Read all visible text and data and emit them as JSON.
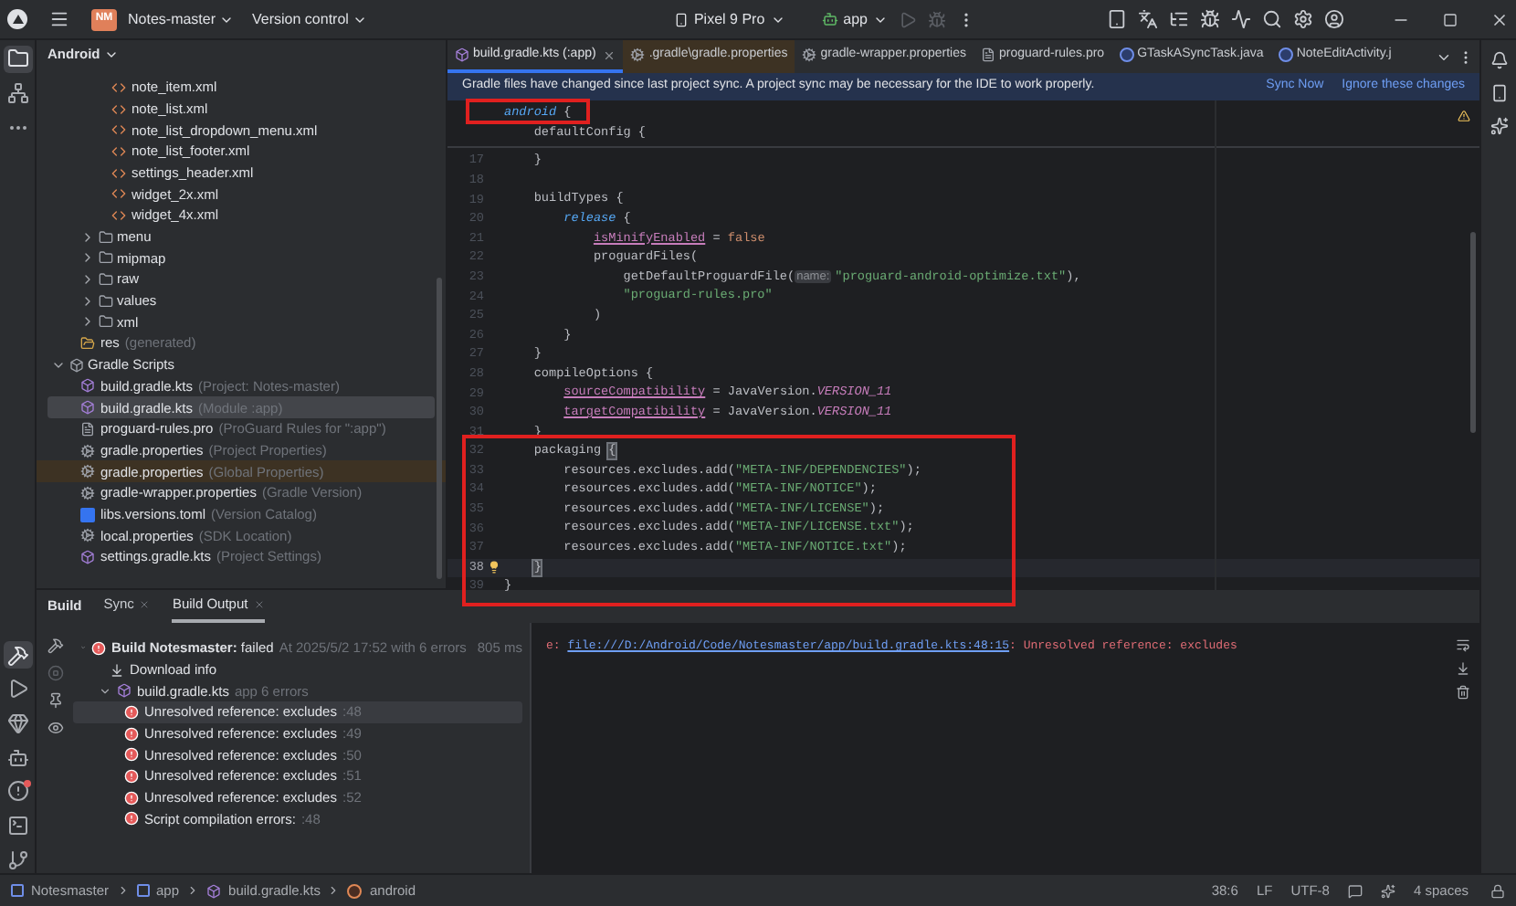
{
  "title_bar": {
    "project_badge": "NM",
    "project": "Notes-master",
    "vcs": "Version control",
    "device": "Pixel 9 Pro",
    "run_config": "app"
  },
  "left_toolbar": {
    "top": [
      {
        "kind": "project",
        "selected": true
      },
      {
        "kind": "structure",
        "selected": false
      },
      {
        "kind": "more",
        "selected": false
      }
    ],
    "bottom": [
      {
        "kind": "build",
        "selected": true
      },
      {
        "kind": "run",
        "selected": false
      },
      {
        "kind": "gem",
        "selected": false
      },
      {
        "kind": "robot",
        "selected": false
      },
      {
        "kind": "problems",
        "selected": false
      },
      {
        "kind": "terminal",
        "selected": false
      },
      {
        "kind": "git",
        "selected": false
      }
    ]
  },
  "project_panel": {
    "view": "Android",
    "res_files": [
      "note_item.xml",
      "note_list.xml",
      "note_list_dropdown_menu.xml",
      "note_list_footer.xml",
      "settings_header.xml",
      "widget_2x.xml",
      "widget_4x.xml"
    ],
    "res_folders": [
      {
        "label": "menu",
        "expanded": false
      },
      {
        "label": "mipmap",
        "expanded": false
      },
      {
        "label": "raw",
        "expanded": false
      },
      {
        "label": "values",
        "expanded": false
      },
      {
        "label": "xml",
        "expanded": false
      }
    ],
    "generated": {
      "label": "res",
      "hint": "(generated)"
    },
    "gradle_scripts": {
      "label": "Gradle Scripts",
      "expanded": true,
      "children": [
        {
          "kind": "gradle",
          "label": "build.gradle.kts",
          "hint": "(Project: Notes-master)",
          "selected": false,
          "marked": false
        },
        {
          "kind": "gradle",
          "label": "build.gradle.kts",
          "hint": "(Module :app)",
          "selected": true,
          "marked": false
        },
        {
          "kind": "rules",
          "label": "proguard-rules.pro",
          "hint": "(ProGuard Rules for \":app\")",
          "selected": false,
          "marked": false
        },
        {
          "kind": "properties",
          "label": "gradle.properties",
          "hint": "(Project Properties)",
          "selected": false,
          "marked": false
        },
        {
          "kind": "properties",
          "label": "gradle.properties",
          "hint": "(Global Properties)",
          "selected": false,
          "marked": true
        },
        {
          "kind": "properties",
          "label": "gradle-wrapper.properties",
          "hint": "(Gradle Version)",
          "selected": false,
          "marked": false
        },
        {
          "kind": "toml",
          "label": "libs.versions.toml",
          "hint": "(Version Catalog)",
          "selected": false,
          "marked": false
        },
        {
          "kind": "properties",
          "label": "local.properties",
          "hint": "(SDK Location)",
          "selected": false,
          "marked": false
        },
        {
          "kind": "gradle",
          "label": "settings.gradle.kts",
          "hint": "(Project Settings)",
          "selected": false,
          "marked": false
        }
      ]
    }
  },
  "editor_tabs": [
    {
      "kind": "gradle",
      "label": "build.gradle.kts (:app)",
      "selected": true,
      "marked": false,
      "closable": true
    },
    {
      "kind": "properties",
      "label": ".gradle\\gradle.properties",
      "selected": false,
      "marked": true,
      "closable": false
    },
    {
      "kind": "properties",
      "label": "gradle-wrapper.properties",
      "selected": false,
      "marked": false,
      "closable": false
    },
    {
      "kind": "rules",
      "label": "proguard-rules.pro",
      "selected": false,
      "marked": false,
      "closable": false
    },
    {
      "kind": "java",
      "label": "GTaskASyncTask.java",
      "selected": false,
      "marked": false,
      "closable": false
    },
    {
      "kind": "java",
      "label": "NoteEditActivity.j",
      "selected": false,
      "marked": false,
      "closable": false
    }
  ],
  "notification": {
    "message": "Gradle files have changed since last project sync. A project sync may be necessary for the IDE to work properly.",
    "actions": [
      "Sync Now",
      "Ignore these changes"
    ]
  },
  "sticky_lines": [
    [
      {
        "kind": "keyword",
        "text": "android"
      },
      {
        "kind": "plain",
        "text": " {"
      }
    ],
    [
      {
        "kind": "plain",
        "text": "    defaultConfig {"
      }
    ]
  ],
  "code_lines": [
    {
      "number": "17",
      "current": false,
      "tokens": [
        {
          "kind": "plain",
          "text": "    }"
        }
      ]
    },
    {
      "number": "18",
      "current": false
    },
    {
      "number": "19",
      "current": false,
      "tokens": [
        {
          "kind": "plain",
          "text": "    buildTypes {"
        }
      ]
    },
    {
      "number": "20",
      "current": false,
      "tokens": [
        {
          "kind": "keyword",
          "text": "        release"
        },
        {
          "kind": "plain",
          "text": " {"
        }
      ]
    },
    {
      "number": "21",
      "current": false,
      "tokens": [
        {
          "kind": "property",
          "text": "            isMinifyEnabled"
        },
        {
          "kind": "plain",
          "text": " = "
        },
        {
          "kind": "literal",
          "text": "false"
        }
      ]
    },
    {
      "number": "22",
      "current": false,
      "tokens": [
        {
          "kind": "plain",
          "text": "            proguardFiles("
        }
      ]
    },
    {
      "number": "23",
      "current": false,
      "tokens": [
        {
          "kind": "plain",
          "text": "                getDefaultProguardFile("
        },
        {
          "kind": "hint",
          "text": "name:"
        },
        {
          "kind": "string",
          "text": "\"proguard-android-optimize.txt\""
        },
        {
          "kind": "plain",
          "text": "),"
        }
      ]
    },
    {
      "number": "24",
      "current": false,
      "tokens": [
        {
          "kind": "string",
          "text": "                \"proguard-rules.pro\""
        }
      ]
    },
    {
      "number": "25",
      "current": false,
      "tokens": [
        {
          "kind": "plain",
          "text": "            )"
        }
      ]
    },
    {
      "number": "26",
      "current": false,
      "tokens": [
        {
          "kind": "plain",
          "text": "        }"
        }
      ]
    },
    {
      "number": "27",
      "current": false,
      "tokens": [
        {
          "kind": "plain",
          "text": "    }"
        }
      ]
    },
    {
      "number": "28",
      "current": false,
      "tokens": [
        {
          "kind": "plain",
          "text": "    compileOptions {"
        }
      ]
    },
    {
      "number": "29",
      "current": false,
      "tokens": [
        {
          "kind": "property",
          "text": "        sourceCompatibility"
        },
        {
          "kind": "plain",
          "text": " = JavaVersion."
        },
        {
          "kind": "constant",
          "text": "VERSION_11"
        }
      ]
    },
    {
      "number": "30",
      "current": false,
      "tokens": [
        {
          "kind": "property",
          "text": "        targetCompatibility"
        },
        {
          "kind": "plain",
          "text": " = JavaVersion."
        },
        {
          "kind": "constant",
          "text": "VERSION_11"
        }
      ]
    },
    {
      "number": "31",
      "current": false,
      "tokens": [
        {
          "kind": "plain",
          "text": "    }"
        }
      ]
    },
    {
      "number": "32",
      "current": false,
      "tokens": [
        {
          "kind": "plain",
          "text": "    packaging "
        },
        {
          "kind": "matched",
          "text": "{"
        }
      ]
    },
    {
      "number": "33",
      "current": false,
      "tokens": [
        {
          "kind": "plain",
          "text": "        resources.excludes.add("
        },
        {
          "kind": "string",
          "text": "\"META-INF/DEPENDENCIES\""
        },
        {
          "kind": "plain",
          "text": ");"
        }
      ]
    },
    {
      "number": "34",
      "current": false,
      "tokens": [
        {
          "kind": "plain",
          "text": "        resources.excludes.add("
        },
        {
          "kind": "string",
          "text": "\"META-INF/NOTICE\""
        },
        {
          "kind": "plain",
          "text": ");"
        }
      ]
    },
    {
      "number": "35",
      "current": false,
      "tokens": [
        {
          "kind": "plain",
          "text": "        resources.excludes.add("
        },
        {
          "kind": "string",
          "text": "\"META-INF/LICENSE\""
        },
        {
          "kind": "plain",
          "text": ");"
        }
      ]
    },
    {
      "number": "36",
      "current": false,
      "tokens": [
        {
          "kind": "plain",
          "text": "        resources.excludes.add("
        },
        {
          "kind": "string",
          "text": "\"META-INF/LICENSE.txt\""
        },
        {
          "kind": "plain",
          "text": ");"
        }
      ]
    },
    {
      "number": "37",
      "current": false,
      "tokens": [
        {
          "kind": "plain",
          "text": "        resources.excludes.add("
        },
        {
          "kind": "string",
          "text": "\"META-INF/NOTICE.txt\""
        },
        {
          "kind": "plain",
          "text": ");"
        }
      ]
    },
    {
      "number": "38",
      "current": true,
      "tokens": [
        {
          "kind": "matched",
          "text": "    }"
        }
      ]
    },
    {
      "number": "39",
      "current": false,
      "tokens": [
        {
          "kind": "plain",
          "text": "}"
        }
      ]
    }
  ],
  "tool_window": {
    "title": "Build",
    "tabs": [
      {
        "label": "Sync",
        "selected": false
      },
      {
        "label": "Build Output",
        "selected": true
      }
    ]
  },
  "build_tree": {
    "title": "**Build Notesmaster:** failed",
    "detail": "At 2025/5/2 17:52 with 6 errors",
    "time": "805 ms",
    "expanded": true,
    "children": [
      {
        "kind": "download",
        "label": "Download info",
        "selected": false
      },
      {
        "kind": "file",
        "label": "build.gradle.kts",
        "detail": "app 6 errors",
        "selected": false,
        "expanded": true,
        "children": [
          {
            "kind": "error",
            "label": "Unresolved reference: excludes",
            "detail": ":48",
            "selected": true
          },
          {
            "kind": "error",
            "label": "Unresolved reference: excludes",
            "detail": ":49",
            "selected": false
          },
          {
            "kind": "error",
            "label": "Unresolved reference: excludes",
            "detail": ":50",
            "selected": false
          },
          {
            "kind": "error",
            "label": "Unresolved reference: excludes",
            "detail": ":51",
            "selected": false
          },
          {
            "kind": "error",
            "label": "Unresolved reference: excludes",
            "detail": ":52",
            "selected": false
          },
          {
            "kind": "error",
            "label": "Script compilation errors:",
            "detail": ":48",
            "selected": false
          }
        ]
      }
    ]
  },
  "console": {
    "prefix": "e: ",
    "link": "file:///D:/Android/Code/Notesmaster/app/build.gradle.kts:48:15",
    "message": ": Unresolved reference: excludes"
  },
  "status_bar": {
    "breadcrumbs": [
      {
        "kind": "module",
        "label": "Notesmaster"
      },
      {
        "kind": "module",
        "label": "app"
      },
      {
        "kind": "gradle",
        "label": "build.gradle.kts"
      },
      {
        "kind": "class",
        "label": "android"
      }
    ],
    "position": "38:6",
    "line_separator": "LF",
    "encoding": "UTF-8",
    "indent": "4 spaces"
  }
}
